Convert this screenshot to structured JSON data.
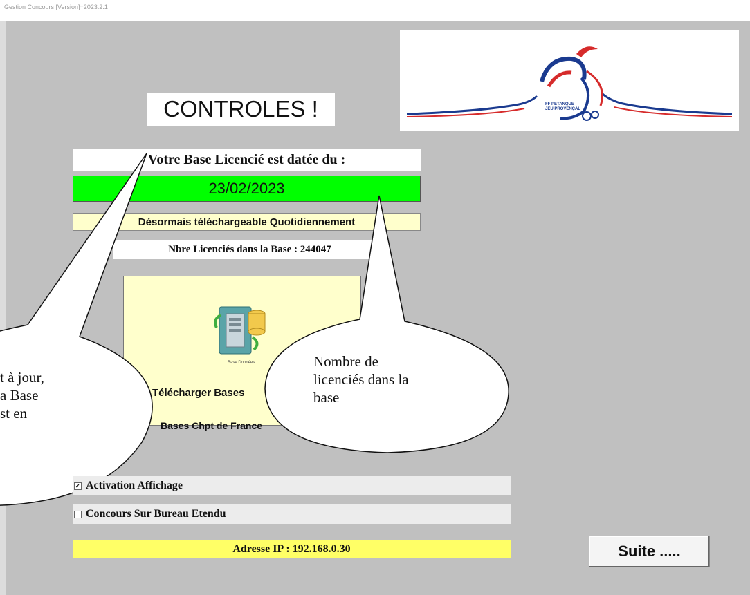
{
  "window": {
    "title": "Gestion Concours [Version]=2023.2.1"
  },
  "logo": {
    "line1": "FF PETANQUE",
    "line2": "JEU PROVENÇAL"
  },
  "heading": "CONTROLES !",
  "base": {
    "date_header": "Votre Base Licencié est datée du :",
    "date_value": "23/02/2023",
    "daily_note": "Désormais téléchargeable Quotidiennement",
    "count_label": "Nbre Licenciés dans la Base : 244047"
  },
  "download": {
    "icon_caption": "Base Données",
    "label": "Télécharger Bases",
    "label2": "Bases Chpt de France"
  },
  "options": {
    "activation": {
      "label": "Activation Affichage",
      "checked": true
    },
    "bureau": {
      "label": "Concours Sur Bureau Etendu",
      "checked": false
    }
  },
  "ip_label": "Adresse IP : 192.168.0.30",
  "suite_label": "Suite .....",
  "callouts": {
    "left": [
      "t à jour,",
      "a Base",
      "st en"
    ],
    "right": [
      "Nombre de",
      "licenciés dans la",
      "base"
    ]
  },
  "colors": {
    "date_ok": "#00ff00",
    "note_bg": "#ffffcc",
    "ip_bg": "#ffff66",
    "window_bg": "#c0c0c0"
  }
}
